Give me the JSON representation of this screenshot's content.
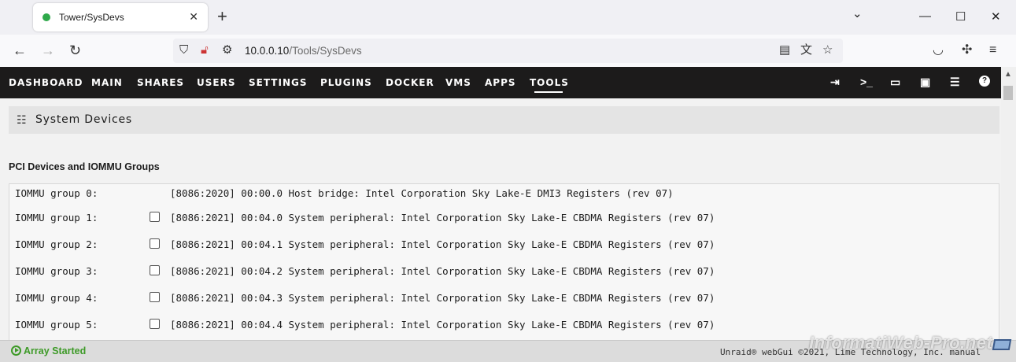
{
  "browser": {
    "tab_title": "Tower/SysDevs",
    "tab_close": "✕",
    "new_tab": "+",
    "window_controls": {
      "dropdown": "⌄",
      "minimize": "—",
      "maximize": "☐",
      "close": "✕"
    },
    "url_host": "10.0.0.10",
    "url_path": "/Tools/SysDevs",
    "icons": [
      "back-icon",
      "forward-icon",
      "reload-icon",
      "shield-icon",
      "lock-icon",
      "permissions-icon",
      "reader-icon",
      "translate-icon",
      "bookmark-star-icon",
      "pocket-icon",
      "extensions-icon",
      "menu-icon"
    ]
  },
  "menu": {
    "items": [
      "DASHBOARD",
      "MAIN",
      "SHARES",
      "USERS",
      "SETTINGS",
      "PLUGINS",
      "DOCKER",
      "VMS",
      "APPS",
      "TOOLS"
    ],
    "active": "TOOLS",
    "right_icons": [
      "logout-icon",
      "terminal-icon",
      "feedback-icon",
      "display-icon",
      "log-icon",
      "help-icon"
    ]
  },
  "page": {
    "title": "System Devices",
    "section_title": "PCI Devices and IOMMU Groups",
    "devices": [
      {
        "group": "IOMMU group 0:",
        "checkbox": false,
        "device": "[8086:2020] 00:00.0 Host bridge: Intel Corporation Sky Lake-E DMI3 Registers (rev 07)"
      },
      {
        "group": "IOMMU group 1:",
        "checkbox": true,
        "device": "[8086:2021] 00:04.0 System peripheral: Intel Corporation Sky Lake-E CBDMA Registers (rev 07)"
      },
      {
        "group": "IOMMU group 2:",
        "checkbox": true,
        "device": "[8086:2021] 00:04.1 System peripheral: Intel Corporation Sky Lake-E CBDMA Registers (rev 07)"
      },
      {
        "group": "IOMMU group 3:",
        "checkbox": true,
        "device": "[8086:2021] 00:04.2 System peripheral: Intel Corporation Sky Lake-E CBDMA Registers (rev 07)"
      },
      {
        "group": "IOMMU group 4:",
        "checkbox": true,
        "device": "[8086:2021] 00:04.3 System peripheral: Intel Corporation Sky Lake-E CBDMA Registers (rev 07)"
      },
      {
        "group": "IOMMU group 5:",
        "checkbox": true,
        "device": "[8086:2021] 00:04.4 System peripheral: Intel Corporation Sky Lake-E CBDMA Registers (rev 07)"
      }
    ]
  },
  "footer": {
    "status": "Array Started",
    "copyright": "Unraid® webGui ©2021, Lime Technology, Inc. manual",
    "watermark": "InformatiWeb-Pro.net"
  },
  "colors": {
    "menubar": "#1c1b1b",
    "status_green": "#3d9a27",
    "tab_dot": "#2ea94a"
  }
}
